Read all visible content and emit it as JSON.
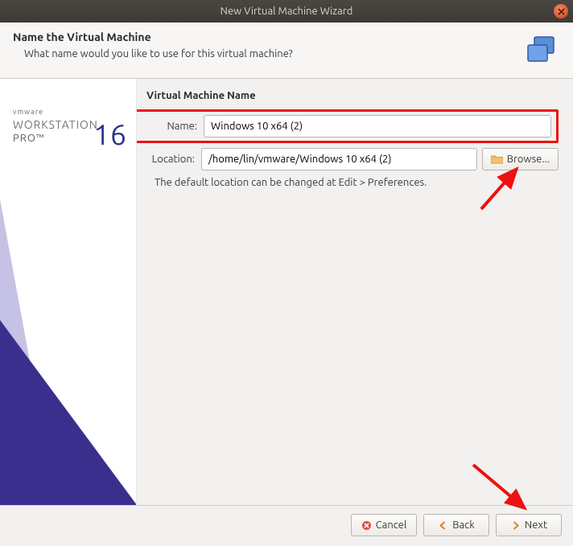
{
  "window": {
    "title": "New Virtual Machine Wizard"
  },
  "header": {
    "heading": "Name the Virtual Machine",
    "subheading": "What name would you like to use for this virtual machine?"
  },
  "sidebar": {
    "brand": "vmware",
    "product1": "WORKSTATION",
    "product2": "PRO™",
    "version": "16"
  },
  "form": {
    "section_title": "Virtual Machine Name",
    "name_label": "Name:",
    "name_value": "Windows 10 x64 (2)",
    "location_label": "Location:",
    "location_value": "/home/lin/vmware/Windows 10 x64 (2)",
    "browse_label": "Browse...",
    "hint": "The default location can be changed at Edit > Preferences."
  },
  "footer": {
    "cancel": "Cancel",
    "back": "Back",
    "next": "Next"
  }
}
